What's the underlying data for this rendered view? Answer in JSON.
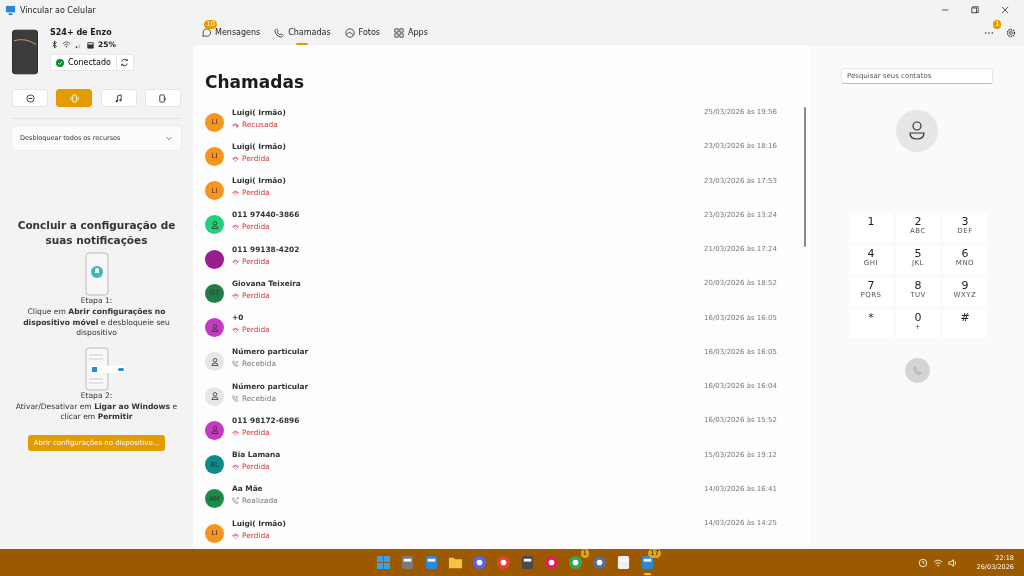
{
  "window": {
    "title": "Vincular ao Celular"
  },
  "device": {
    "name": "S24+ de Enzo",
    "battery": "25%",
    "status": "Conectado"
  },
  "modes": [
    {
      "kind": "dnd",
      "selected": false
    },
    {
      "kind": "vibrate",
      "selected": true
    },
    {
      "kind": "music",
      "selected": false
    },
    {
      "kind": "screen",
      "selected": false
    }
  ],
  "unlock": {
    "label": "Desbloquear todos os recursos",
    "expanded": false
  },
  "setup": {
    "title": "Concluir a configuração de suas notificações",
    "step1_label": "Etapa 1:",
    "step1_text": "Clique em **Abrir configurações no dispositivo móvel** e desbloqueie seu dispositivo",
    "step2_label": "Etapa 2:",
    "step2_text": "Ativar/Desativar em **Ligar ao Windows** e clicar em **Permitir**",
    "button": "Abrir configurações no dispositivo..."
  },
  "tabs": [
    {
      "label": "Mensagens",
      "kind": "messages",
      "badge": "10",
      "selected": false
    },
    {
      "label": "Chamadas",
      "kind": "calls",
      "selected": true
    },
    {
      "label": "Fotos",
      "kind": "photos",
      "selected": false
    },
    {
      "label": "Apps",
      "kind": "apps",
      "selected": false
    }
  ],
  "header": {
    "notifications_badge": "1"
  },
  "calls": {
    "title": "Chamadas",
    "items": [
      {
        "name": "Luigi( Irmão)",
        "avatar": "LI",
        "color": "#f7941d",
        "status": "Recusada",
        "kind": "declined",
        "time": "25/03/2026 às 19:56"
      },
      {
        "name": "Luigi( Irmão)",
        "avatar": "LI",
        "color": "#f7941d",
        "status": "Perdida",
        "kind": "missed",
        "time": "23/03/2026 às 18:16"
      },
      {
        "name": "Luigi( Irmão)",
        "avatar": "LI",
        "color": "#f7941d",
        "status": "Perdida",
        "kind": "missed",
        "time": "23/03/2026 às 17:53"
      },
      {
        "name": "011 97440-3866",
        "color": "#25d07a",
        "status": "Perdida",
        "kind": "missed",
        "time": "23/03/2026 às 13:24"
      },
      {
        "name": "011 99138-4202",
        "avatar": "...",
        "color": "#9b1b93",
        "status": "Perdida",
        "kind": "missed",
        "time": "21/03/2026 às 17:24"
      },
      {
        "name": "Giovana Teixeira",
        "avatar": "GT",
        "color": "#1e7e45",
        "status": "Perdida",
        "kind": "missed",
        "time": "20/03/2026 às 18:52"
      },
      {
        "name": "+0",
        "color": "#c23cc0",
        "status": "Perdida",
        "kind": "missed",
        "time": "16/03/2026 às 16:05"
      },
      {
        "name": "Número particular",
        "color": "#e6e6e6",
        "status": "Recebida",
        "kind": "received",
        "time": "16/03/2026 às 16:05"
      },
      {
        "name": "Número particular",
        "color": "#e6e6e6",
        "status": "Recebida",
        "kind": "received",
        "time": "16/03/2026 às 16:04"
      },
      {
        "name": "011 98172-6896",
        "color": "#c23cc0",
        "status": "Perdida",
        "kind": "missed",
        "time": "16/03/2026 às 15:52"
      },
      {
        "name": "Bia Lamana",
        "avatar": "BL",
        "color": "#0f8a8a",
        "status": "Perdida",
        "kind": "missed",
        "time": "15/03/2026 às 19:12"
      },
      {
        "name": "Aa Mãe",
        "avatar": "AM",
        "color": "#1a8c4a",
        "status": "Realizada",
        "kind": "outgoing",
        "time": "14/03/2026 às 16:41"
      },
      {
        "name": "Luigi( Irmão)",
        "avatar": "LI",
        "color": "#f7941d",
        "status": "Perdida",
        "kind": "missed",
        "time": "14/03/2026 às 14:25"
      }
    ]
  },
  "dialer": {
    "search_placeholder": "Pesquisar seus contatos",
    "keys": [
      {
        "digit": "1"
      },
      {
        "digit": "2",
        "letters": "ABC"
      },
      {
        "digit": "3",
        "letters": "DEF"
      },
      {
        "digit": "4",
        "letters": "GHI"
      },
      {
        "digit": "5",
        "letters": "JKL"
      },
      {
        "digit": "6",
        "letters": "MNO"
      },
      {
        "digit": "7",
        "letters": "PQRS"
      },
      {
        "digit": "8",
        "letters": "TUV"
      },
      {
        "digit": "9",
        "letters": "WXYZ"
      },
      {
        "digit": "*"
      },
      {
        "digit": "0",
        "letters": "+"
      },
      {
        "digit": "#"
      }
    ]
  },
  "taskbar": {
    "apps": [
      {
        "kind": "start",
        "color": "#3aa0e8"
      },
      {
        "kind": "window",
        "color": "#7a7a7a"
      },
      {
        "kind": "notepad",
        "color": "#2b88d8"
      },
      {
        "kind": "folder",
        "color": "#f5c242"
      },
      {
        "kind": "chat",
        "color": "#5865f2"
      },
      {
        "kind": "browser",
        "color": "#e94235"
      },
      {
        "kind": "calculator",
        "color": "#4a4a4a"
      },
      {
        "kind": "slack",
        "color": "#e01e5a"
      },
      {
        "kind": "browser",
        "color": "#34a853",
        "badge": "1"
      },
      {
        "kind": "shield",
        "color": "#5a6f8a"
      },
      {
        "kind": "store",
        "color": "#f0f0f0"
      },
      {
        "kind": "phone",
        "color": "#2b88d8",
        "badge": "17",
        "selected": true
      }
    ],
    "time": "22:18",
    "date": "26/03/2026"
  }
}
